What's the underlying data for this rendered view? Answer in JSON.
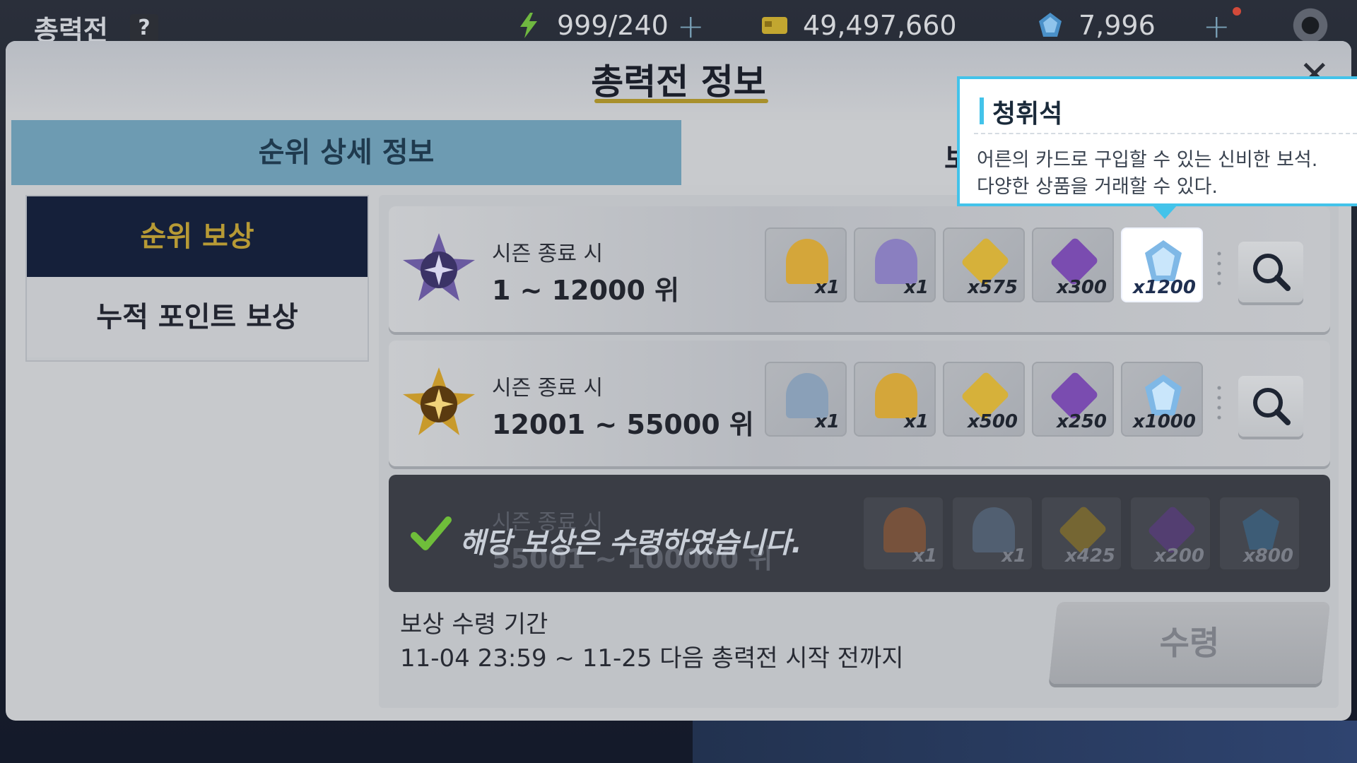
{
  "hud": {
    "screen_title": "총력전",
    "help_label": "?",
    "stamina": "999/240",
    "credits": "49,497,660",
    "gems": "7,996",
    "plus": "+",
    "icons": [
      "lightning-icon",
      "credit-card-icon",
      "gem-icon",
      "gear-icon"
    ]
  },
  "modal": {
    "title": "총력전 정보",
    "close_label": "✕",
    "tabs": [
      {
        "label": "순위 상세 정보",
        "active": true
      },
      {
        "label": "보",
        "active": false
      }
    ],
    "sidebar": [
      {
        "label": "순위 보상",
        "active": true
      },
      {
        "label": "누적 포인트 보상",
        "active": false
      }
    ],
    "rows": [
      {
        "subtitle": "시즌 종료 시",
        "rank": "1 ~ 12000 위",
        "items": [
          {
            "qty": "x1",
            "color": "#d4a63a"
          },
          {
            "qty": "x1",
            "color": "#8a7fc0"
          },
          {
            "qty": "x575",
            "color": "#d6b13a"
          },
          {
            "qty": "x300",
            "color": "#7a4cb0"
          },
          {
            "qty": "x1200",
            "color": "#7fb8e6",
            "highlighted": true
          }
        ]
      },
      {
        "subtitle": "시즌 종료 시",
        "rank": "12001 ~ 55000 위",
        "items": [
          {
            "qty": "x1",
            "color": "#8aa0b8"
          },
          {
            "qty": "x1",
            "color": "#d4a63a"
          },
          {
            "qty": "x500",
            "color": "#d6b13a"
          },
          {
            "qty": "x250",
            "color": "#7a4cb0"
          },
          {
            "qty": "x1000",
            "color": "#7fb8e6"
          }
        ]
      },
      {
        "subtitle": "시즌 종료 시",
        "rank": "55001 ~ 100000 위",
        "claimed_text": "해당 보상은 수령하였습니다.",
        "items": [
          {
            "qty": "x1",
            "color": "#9a5a30"
          },
          {
            "qty": "x1",
            "color": "#5a6f88"
          },
          {
            "qty": "x425",
            "color": "#8a7428"
          },
          {
            "qty": "x200",
            "color": "#5a3a80"
          },
          {
            "qty": "x800",
            "color": "#3a6a90"
          }
        ]
      }
    ],
    "period_label": "보상 수령 기간",
    "period_range": "11-04 23:59 ~ 11-25 다음 총력전 시작 전까지",
    "claim_button": "수령"
  },
  "tooltip": {
    "title": "청휘석",
    "desc_line1": "어른의 카드로 구입할 수 있는 신비한 보석.",
    "desc_line2": "다양한 상품을 거래할 수 있다."
  }
}
